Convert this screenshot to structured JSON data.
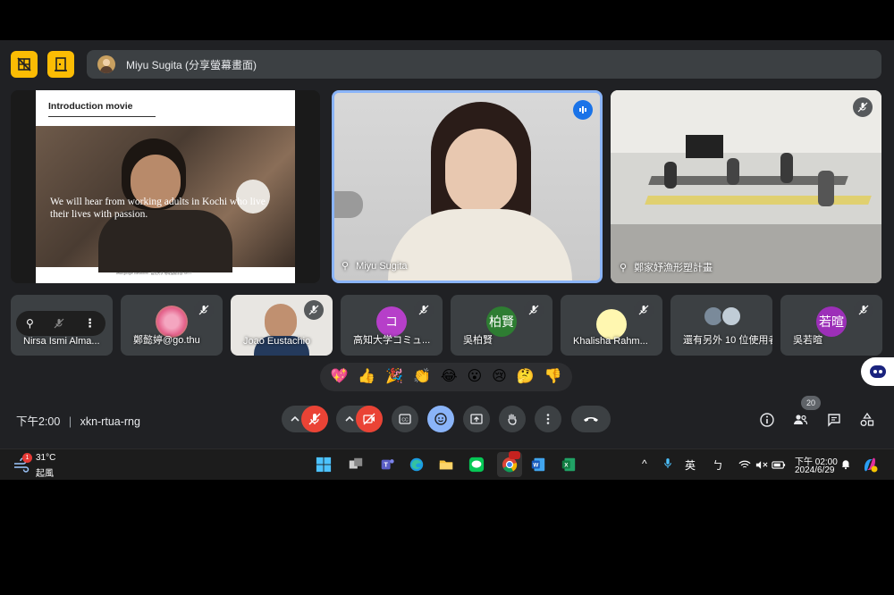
{
  "presenter": {
    "label": "Miyu Sugita (分享螢幕畫面)"
  },
  "share": {
    "slide_title": "Introduction movie",
    "caption": "We will hear from working adults in Kochi who live their lives with passion.",
    "footer": "www.google.com/kochi - 高知大学 地域協働学部  SRTT"
  },
  "speaker": {
    "name": "Miyu Sugita"
  },
  "lab": {
    "name": "鄭家妤漁形塑計畫"
  },
  "participants": [
    {
      "name": "Nirsa Ismi Alma..."
    },
    {
      "name": "鄭懿婷@go.thu"
    },
    {
      "name": "Joao Eustachio"
    },
    {
      "name": "高知大学コミュ...",
      "initial": "コ",
      "color": "#b63fc9"
    },
    {
      "name": "吳柏賢",
      "initial": "柏賢",
      "color": "#2e7d32"
    },
    {
      "name": "Khalisha Rahm..."
    },
    {
      "name": "還有另外 10 位使用者"
    },
    {
      "name": "吳若暄",
      "initial": "若暄",
      "color": "#9c2fb8"
    }
  ],
  "reactions": [
    "💖",
    "👍",
    "🎉",
    "👏",
    "😂",
    "😮",
    "😢",
    "🤔",
    "👎"
  ],
  "controls": {
    "time": "下午2:00",
    "separator": "|",
    "meeting_code": "xkn-rtua-rng",
    "people_count": "20"
  },
  "taskbar": {
    "weather_temp": "31°C",
    "weather_desc": "起風",
    "weather_badge": "1",
    "ime": "英",
    "ime2": "ㄅ",
    "clock_time": "下午 02:00",
    "clock_date": "2024/6/29"
  },
  "colors": {
    "accent": "#8ab4f8",
    "danger": "#ea4335",
    "amber": "#fbbc04",
    "bg": "#202124"
  }
}
